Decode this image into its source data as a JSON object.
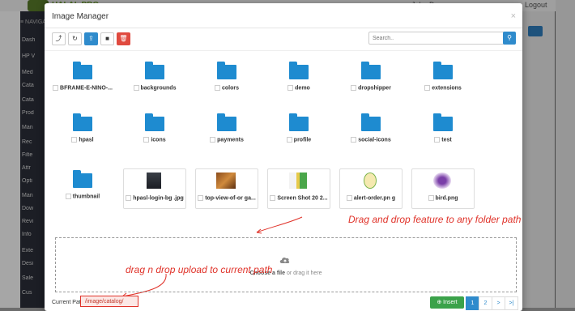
{
  "background": {
    "brand": "HALAL",
    "brand_suffix": "PRO",
    "user": "John Doe",
    "logout": "Logout",
    "nav_header": "≡ NAVIGA",
    "sidebar_items": [
      "Dash",
      "HP V",
      "Med",
      "Cata",
      "Cata",
      "Prod",
      "Man",
      "Rec",
      "Filte",
      "Attr",
      "Opti",
      "Man",
      "Dow",
      "Revi",
      "Info",
      "Exte",
      "Desi",
      "Sale",
      "Cus"
    ]
  },
  "modal": {
    "title": "Image Manager",
    "close": "×",
    "toolbar": {
      "parent_icon": "⤴",
      "refresh_icon": "↻",
      "upload_icon": "⇪",
      "folder_icon": "■",
      "delete_icon": "🗑"
    },
    "search": {
      "placeholder": "Search..",
      "button_icon": "⚲"
    },
    "folders": [
      {
        "label": "BFRAME-E-NINO-..."
      },
      {
        "label": "backgrounds"
      },
      {
        "label": "colors"
      },
      {
        "label": "demo"
      },
      {
        "label": "dropshipper"
      },
      {
        "label": "extensions"
      },
      {
        "label": "hpasl"
      },
      {
        "label": "icons"
      },
      {
        "label": "payments"
      },
      {
        "label": "profile"
      },
      {
        "label": "social-icons"
      },
      {
        "label": "test"
      },
      {
        "label": "thumbnail"
      }
    ],
    "images": [
      {
        "label": "hpasl-login-bg .jpg"
      },
      {
        "label": "top-view-of-or ga..."
      },
      {
        "label": "Screen Shot 20 2..."
      },
      {
        "label": "alert-order.pn g"
      },
      {
        "label": "bird.png"
      }
    ],
    "dropzone": {
      "choose_file": "Choose a file",
      "drag_text": " or drag it here"
    },
    "annotations": {
      "folder_drag": "Drag and drop feature to any folder path",
      "upload_drag": "drag n drop upload to current path"
    },
    "footer": {
      "current_path_label": "Current Path:",
      "current_path_value": "/image/catalog/",
      "insert_label": "Insert",
      "pagination": [
        "1",
        "2",
        ">",
        ">|"
      ]
    }
  },
  "colors": {
    "accent": "#2f8bcc",
    "danger": "#e04a3f",
    "success": "#3ba24a",
    "annotation": "#e0332a",
    "folder": "#1e8bd0"
  }
}
